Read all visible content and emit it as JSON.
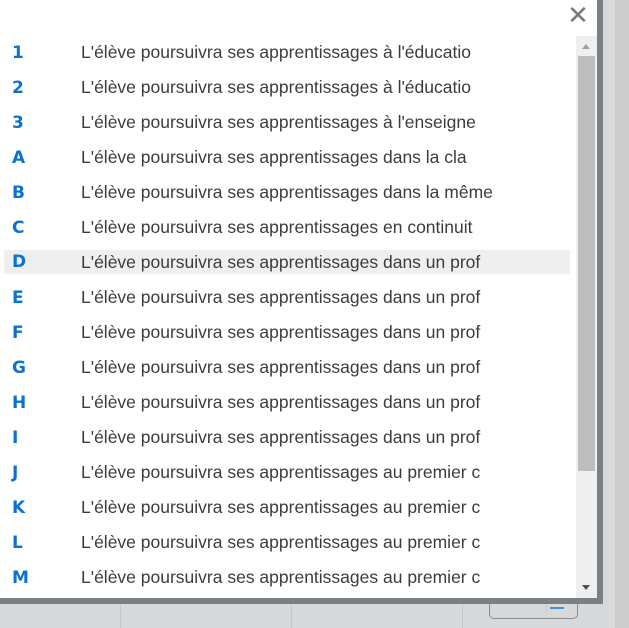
{
  "dialog": {
    "close_icon": "close-icon"
  },
  "items": [
    {
      "key": "1",
      "text": "L'élève poursuivra ses apprentissages à l'éducatio"
    },
    {
      "key": "2",
      "text": "L'élève poursuivra ses apprentissages à l'éducatio"
    },
    {
      "key": "3",
      "text": "L'élève poursuivra ses apprentissages à l'enseigne"
    },
    {
      "key": "A",
      "text": "L'élève poursuivra ses apprentissages dans la cla"
    },
    {
      "key": "B",
      "text": "L'élève poursuivra ses apprentissages dans la même"
    },
    {
      "key": "C",
      "text": "L'élève poursuivra ses apprentissages en continuit"
    },
    {
      "key": "D",
      "text": "L'élève poursuivra ses apprentissages dans un prof",
      "highlighted": true
    },
    {
      "key": "E",
      "text": "L'élève poursuivra ses apprentissages dans un prof"
    },
    {
      "key": "F",
      "text": "L'élève poursuivra ses apprentissages dans un prof"
    },
    {
      "key": "G",
      "text": "L'élève poursuivra ses apprentissages dans un prof"
    },
    {
      "key": "H",
      "text": "L'élève poursuivra ses apprentissages dans un prof"
    },
    {
      "key": "I",
      "text": "L'élève poursuivra ses apprentissages dans un prof"
    },
    {
      "key": "J",
      "text": "L'élève poursuivra ses apprentissages au premier c"
    },
    {
      "key": "K",
      "text": "L'élève poursuivra ses apprentissages au premier c"
    },
    {
      "key": "L",
      "text": "L'élève poursuivra ses apprentissages au premier c"
    },
    {
      "key": "M",
      "text": "L'élève poursuivra ses apprentissages au premier c"
    }
  ],
  "colors": {
    "key": "#0b72cf",
    "text": "#3c3c3c",
    "highlight": "#efefef",
    "border": "#7a8086"
  }
}
